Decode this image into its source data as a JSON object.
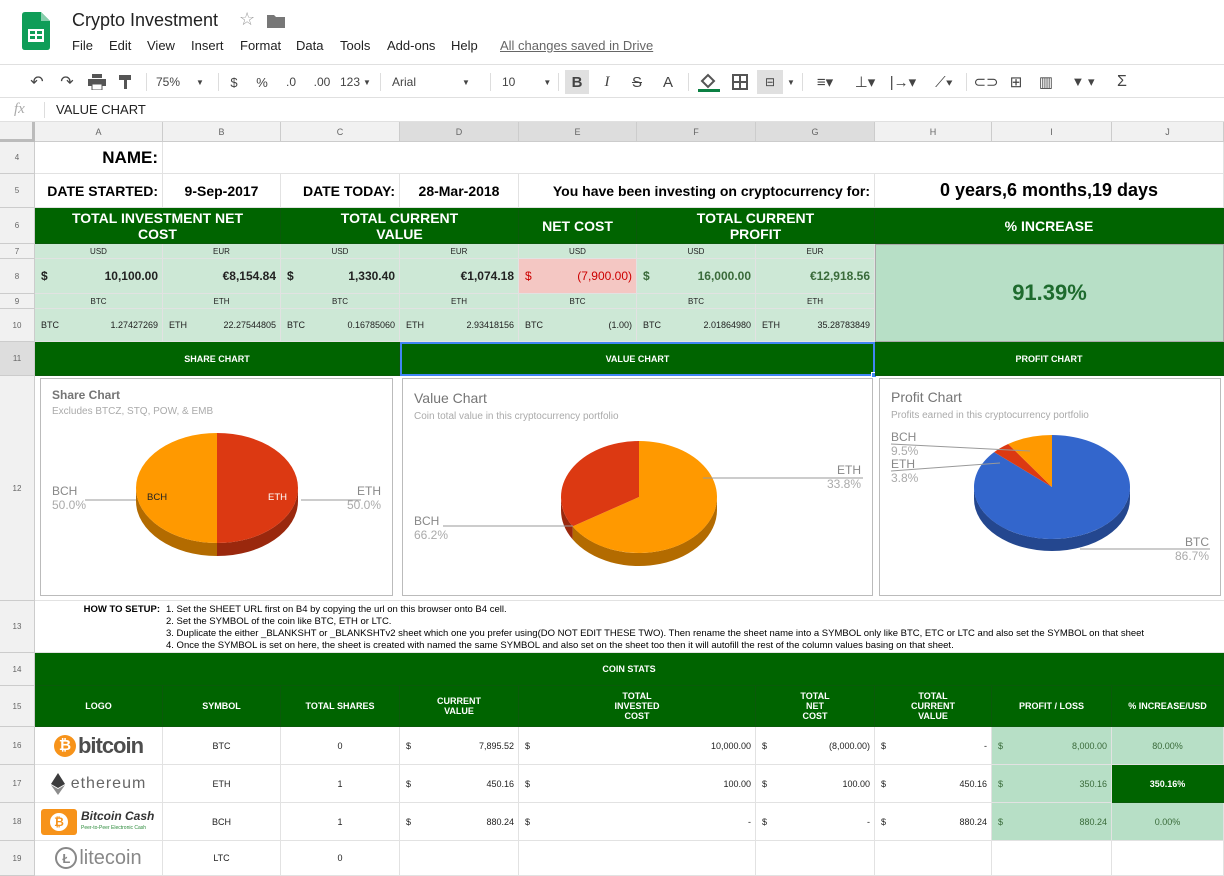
{
  "app": {
    "title": "Crypto Investment",
    "status": "All changes saved in Drive"
  },
  "menu": [
    "File",
    "Edit",
    "View",
    "Insert",
    "Format",
    "Data",
    "Tools",
    "Add-ons",
    "Help"
  ],
  "toolbar": {
    "zoom": "75%",
    "currency": "$",
    "percent": "%",
    "dec_less": ".0",
    "dec_more": ".00",
    "format123": "123",
    "font": "Arial",
    "size": "10",
    "bold": "B",
    "italic": "I",
    "strike": "S",
    "textcolor": "A"
  },
  "formula": {
    "fx": "fx",
    "value": "VALUE CHART"
  },
  "columns": [
    "A",
    "B",
    "C",
    "D",
    "E",
    "F",
    "G",
    "H",
    "I",
    "J"
  ],
  "rows": [
    "4",
    "5",
    "6",
    "7",
    "8",
    "9",
    "10",
    "11",
    "12",
    "13",
    "14",
    "15",
    "16",
    "17",
    "18",
    "19"
  ],
  "r4": {
    "name": "NAME:"
  },
  "r5": {
    "started_label": "DATE STARTED:",
    "started": "9-Sep-2017",
    "today_label": "DATE TODAY:",
    "today": "28-Mar-2018",
    "investing_label": "You have been investing on cryptocurrency for:",
    "duration": "0 years,6 months,19 days"
  },
  "r6": {
    "h1": "TOTAL INVESTMENT NET COST",
    "h2": "TOTAL CURRENT VALUE",
    "h3": "NET COST",
    "h4": "TOTAL CURRENT PROFIT",
    "h5": "% INCREASE"
  },
  "r7": [
    "USD",
    "EUR",
    "USD",
    "EUR",
    "USD",
    "USD",
    "EUR"
  ],
  "r8": {
    "a_sym": "$",
    "a": "10,100.00",
    "b": "€8,154.84",
    "c_sym": "$",
    "c": "1,330.40",
    "d": "€1,074.18",
    "e_sym": "$",
    "e": "(7,900.00)",
    "f_sym": "$",
    "f": "16,000.00",
    "g": "€12,918.56",
    "pct": "91.39%"
  },
  "r9": [
    "BTC",
    "ETH",
    "BTC",
    "ETH",
    "BTC",
    "BTC",
    "ETH"
  ],
  "r10": [
    {
      "s": "BTC",
      "v": "1.27427269"
    },
    {
      "s": "ETH",
      "v": "22.27544805"
    },
    {
      "s": "BTC",
      "v": "0.16785060"
    },
    {
      "s": "ETH",
      "v": "2.93418156"
    },
    {
      "s": "BTC",
      "v": "(1.00)"
    },
    {
      "s": "BTC",
      "v": "2.01864980"
    },
    {
      "s": "ETH",
      "v": "35.28783849"
    }
  ],
  "r11": {
    "share": "SHARE CHART",
    "value": "VALUE CHART",
    "profit": "PROFIT CHART"
  },
  "charts": [
    {
      "title": "Share Chart",
      "subtitle": "Excludes BTCZ, STQ, POW, & EMB",
      "slices": [
        {
          "name": "BCH",
          "pct": "50.0%",
          "value": 50,
          "color": "#ff9900"
        },
        {
          "name": "ETH",
          "pct": "50.0%",
          "value": 50,
          "color": "#dc3912"
        }
      ]
    },
    {
      "title": "Value Chart",
      "subtitle": "Coin total value in this cryptocurrency portfolio",
      "slices": [
        {
          "name": "BCH",
          "pct": "66.2%",
          "value": 66.2,
          "color": "#ff9900"
        },
        {
          "name": "ETH",
          "pct": "33.8%",
          "value": 33.8,
          "color": "#dc3912"
        }
      ]
    },
    {
      "title": "Profit Chart",
      "subtitle": "Profits earned in this cryptocurrency portfolio",
      "slices": [
        {
          "name": "BTC",
          "pct": "86.7%",
          "value": 86.7,
          "color": "#3366cc"
        },
        {
          "name": "ETH",
          "pct": "3.8%",
          "value": 3.8,
          "color": "#dc3912"
        },
        {
          "name": "BCH",
          "pct": "9.5%",
          "value": 9.5,
          "color": "#ff9900"
        }
      ]
    }
  ],
  "howto": {
    "label": "HOW TO SETUP:",
    "lines": [
      "1. Set the SHEET URL first on B4 by copying the url on this browser onto B4 cell.",
      "2. Set the SYMBOL of the coin like BTC, ETH or LTC.",
      "3. Duplicate the either _BLANKSHT or _BLANKSHTv2 sheet which one you prefer using(DO NOT EDIT THESE TWO). Then rename the sheet name into a SYMBOL only like BTC, ETC or LTC and also set the SYMBOL on that sheet",
      "4. Once the SYMBOL is set on here, the sheet is created with named the same SYMBOL and also set on the sheet too then it will autofill the rest of the column values basing on that sheet."
    ]
  },
  "stats": {
    "title": "COIN STATS",
    "headers": [
      "LOGO",
      "SYMBOL",
      "TOTAL SHARES",
      "CURRENT VALUE",
      "TOTAL INVESTED COST",
      "TOTAL NET COST",
      "TOTAL CURRENT VALUE",
      "PROFIT / LOSS",
      "% INCREASE/USD"
    ],
    "rows": [
      {
        "logo": "bitcoin",
        "symbol": "BTC",
        "shares": "0",
        "cur": "7,895.52",
        "inv": "10,000.00",
        "net": "(8,000.00)",
        "tcv": "-",
        "pl": "8,000.00",
        "inc": "80.00%"
      },
      {
        "logo": "ethereum",
        "symbol": "ETH",
        "shares": "1",
        "cur": "450.16",
        "inv": "100.00",
        "net": "100.00",
        "tcv": "450.16",
        "pl": "350.16",
        "inc": "350.16%"
      },
      {
        "logo": "Bitcoin Cash",
        "logo_sub": "Peer-to-Peer Electronic Cash",
        "symbol": "BCH",
        "shares": "1",
        "cur": "880.24",
        "inv": "-",
        "net": "-",
        "tcv": "880.24",
        "pl": "880.24",
        "inc": "0.00%"
      },
      {
        "logo": "litecoin",
        "symbol": "LTC",
        "shares": "0",
        "cur": "",
        "inv": "",
        "net": "",
        "tcv": "",
        "pl": "",
        "inc": ""
      }
    ]
  }
}
